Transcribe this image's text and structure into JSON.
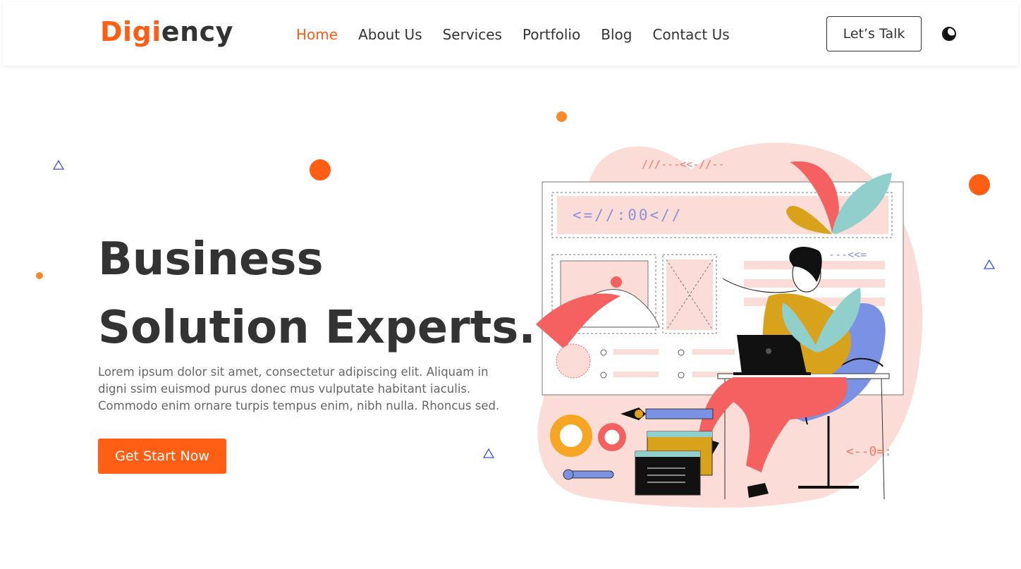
{
  "brand": {
    "logo_part1": "Digi",
    "logo_part2": "ency",
    "accent_color": "#ff5e14"
  },
  "nav": {
    "items": [
      {
        "label": "Home",
        "active": true
      },
      {
        "label": "About Us",
        "active": false
      },
      {
        "label": "Services",
        "active": false
      },
      {
        "label": "Portfolio",
        "active": false
      },
      {
        "label": "Blog",
        "active": false
      },
      {
        "label": "Contact Us",
        "active": false
      }
    ],
    "cta_label": "Let’s Talk",
    "theme_icon": "moon-icon"
  },
  "hero": {
    "title_line1": "Business",
    "title_line2": "Solution Experts.",
    "description": "Lorem ipsum dolor sit amet, consectetur adipiscing elit. Aliquam in digni ssim euismod purus donec mus vulputate habitant iaculis. Commodo enim ornare turpis tempus enim, nibh nulla. Rhoncus sed.",
    "button_label": "Get Start Now"
  },
  "illustration": {
    "code_banner": "<=//:00<//",
    "top_doodle": "///---<<-//--",
    "side_doodle": "---<<=",
    "bottom_doodle": "<--0=:"
  }
}
